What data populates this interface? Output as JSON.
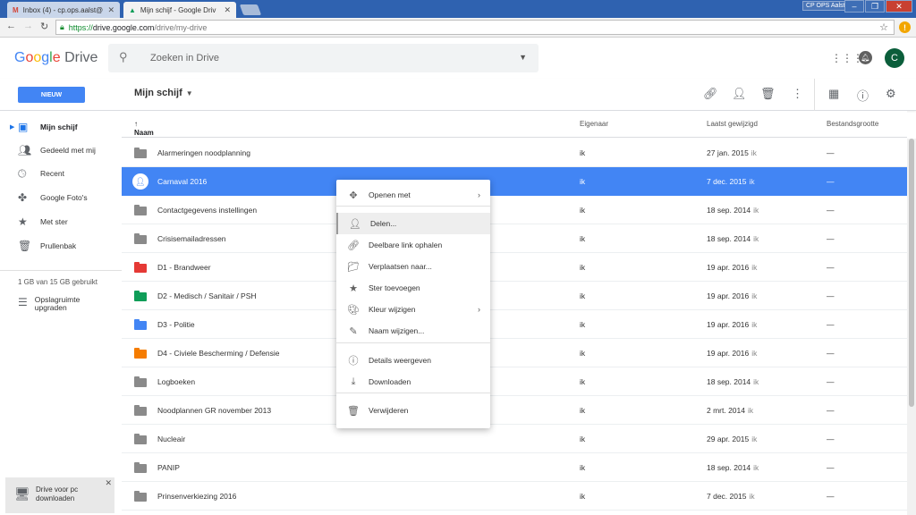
{
  "browser": {
    "tabs": [
      {
        "icon": "M",
        "title": "Inbox (4) - cp.ops.aalst@"
      },
      {
        "icon": "▲",
        "title": "Mijn schijf - Google Driv"
      }
    ],
    "window_user": "CP OPS Aalst",
    "url_scheme": "https://",
    "url_host": "drive.google.com",
    "url_path": "/drive/my-drive",
    "extension_badge": "!"
  },
  "header": {
    "logo_google": [
      "G",
      "o",
      "o",
      "g",
      "l",
      "e"
    ],
    "logo_product": "Drive",
    "search_placeholder": "Zoeken in Drive",
    "avatar_letter": "C"
  },
  "toolbar": {
    "new_label": "NIEUW",
    "breadcrumb": "Mijn schijf"
  },
  "sidebar": {
    "items": [
      {
        "label": "Mijn schijf",
        "icon": "my-drive-icon"
      },
      {
        "label": "Gedeeld met mij",
        "icon": "people-icon"
      },
      {
        "label": "Recent",
        "icon": "clock-icon"
      },
      {
        "label": "Google Foto's",
        "icon": "photos-icon"
      },
      {
        "label": "Met ster",
        "icon": "star-icon"
      },
      {
        "label": "Prullenbak",
        "icon": "trash-icon"
      }
    ],
    "storage": "1 GB van 15 GB gebruikt",
    "upgrade_label": "Opslagruimte upgraden",
    "promo_text": "Drive voor pc downloaden"
  },
  "columns": {
    "name": "Naam",
    "owner": "Eigenaar",
    "modified": "Laatst gewijzigd",
    "size": "Bestandsgrootte"
  },
  "files": [
    {
      "name": "Alarmeringen noodplanning",
      "owner": "ik",
      "date": "27 jan. 2015",
      "by": "ik",
      "size": "—",
      "color": "#8a8a8a"
    },
    {
      "name": "Carnaval 2016",
      "owner": "ik",
      "date": "7 dec. 2015",
      "by": "ik",
      "size": "—",
      "color": "#8a8a8a",
      "selected": true,
      "shared": true
    },
    {
      "name": "Contactgegevens instellingen",
      "owner": "ik",
      "date": "18 sep. 2014",
      "by": "ik",
      "size": "—",
      "color": "#8a8a8a"
    },
    {
      "name": "Crisisemailadressen",
      "owner": "ik",
      "date": "18 sep. 2014",
      "by": "ik",
      "size": "—",
      "color": "#8a8a8a"
    },
    {
      "name": "D1 - Brandweer",
      "owner": "ik",
      "date": "19 apr. 2016",
      "by": "ik",
      "size": "—",
      "color": "#e53935"
    },
    {
      "name": "D2 - Medisch / Sanitair / PSH",
      "owner": "ik",
      "date": "19 apr. 2016",
      "by": "ik",
      "size": "—",
      "color": "#0f9d58"
    },
    {
      "name": "D3 - Politie",
      "owner": "ik",
      "date": "19 apr. 2016",
      "by": "ik",
      "size": "—",
      "color": "#4285f4"
    },
    {
      "name": "D4 - Civiele Bescherming / Defensie",
      "owner": "ik",
      "date": "19 apr. 2016",
      "by": "ik",
      "size": "—",
      "color": "#f57c00"
    },
    {
      "name": "Logboeken",
      "owner": "ik",
      "date": "18 sep. 2014",
      "by": "ik",
      "size": "—",
      "color": "#8a8a8a"
    },
    {
      "name": "Noodplannen GR november 2013",
      "owner": "ik",
      "date": "2 mrt. 2014",
      "by": "ik",
      "size": "—",
      "color": "#8a8a8a"
    },
    {
      "name": "Nucleair",
      "owner": "ik",
      "date": "29 apr. 2015",
      "by": "ik",
      "size": "—",
      "color": "#8a8a8a"
    },
    {
      "name": "PANIP",
      "owner": "ik",
      "date": "18 sep. 2014",
      "by": "ik",
      "size": "—",
      "color": "#8a8a8a"
    },
    {
      "name": "Prinsenverkiezing 2016",
      "owner": "ik",
      "date": "7 dec. 2015",
      "by": "ik",
      "size": "—",
      "color": "#8a8a8a"
    }
  ],
  "context_menu": [
    {
      "label": "Openen met",
      "icon": "move-icon",
      "submenu": true
    },
    {
      "label": "Delen...",
      "icon": "share-person-icon",
      "highlighted": true
    },
    {
      "label": "Deelbare link ophalen",
      "icon": "link-icon"
    },
    {
      "label": "Verplaatsen naar...",
      "icon": "move-to-folder-icon"
    },
    {
      "label": "Ster toevoegen",
      "icon": "star-icon"
    },
    {
      "label": "Kleur wijzigen",
      "icon": "palette-icon",
      "submenu": true
    },
    {
      "label": "Naam wijzigen...",
      "icon": "rename-icon"
    },
    {
      "label": "Details weergeven",
      "icon": "info-icon"
    },
    {
      "label": "Downloaden",
      "icon": "download-icon"
    },
    {
      "label": "Verwijderen",
      "icon": "trash-icon"
    }
  ]
}
